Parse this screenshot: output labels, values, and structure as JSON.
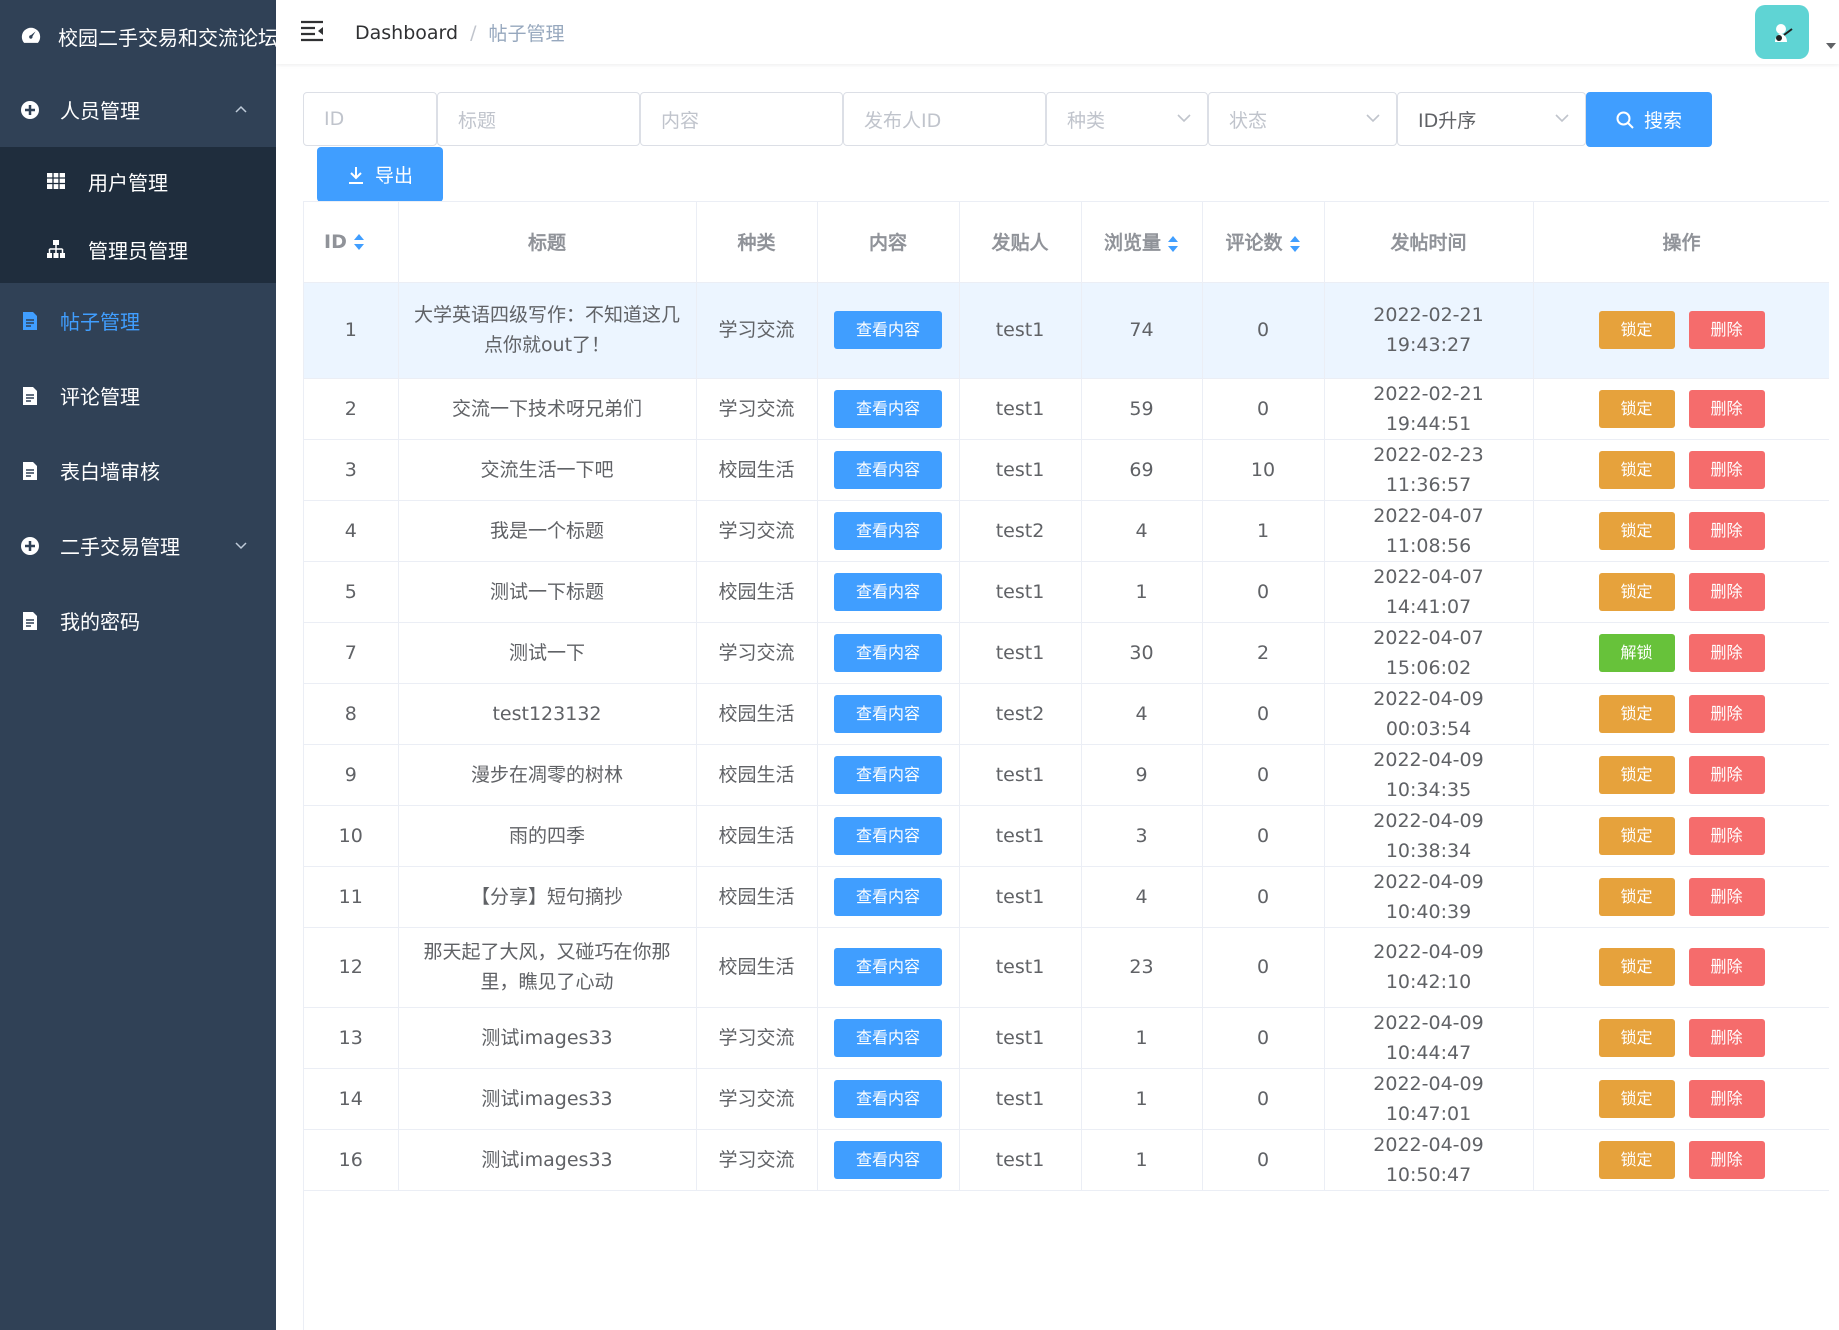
{
  "app_title": "校园二手交易和交流论坛管理系统",
  "sidebar": {
    "items": [
      {
        "label": "人员管理",
        "icon": "circle-plus-icon",
        "expanded": true,
        "children": [
          {
            "label": "用户管理",
            "icon": "table-grid-icon"
          },
          {
            "label": "管理员管理",
            "icon": "org-chart-icon"
          }
        ]
      },
      {
        "label": "帖子管理",
        "icon": "document-icon",
        "active": true
      },
      {
        "label": "评论管理",
        "icon": "document-icon"
      },
      {
        "label": "表白墙审核",
        "icon": "document-icon"
      },
      {
        "label": "二手交易管理",
        "icon": "circle-plus-icon",
        "expanded": false
      },
      {
        "label": "我的密码",
        "icon": "document-icon"
      }
    ]
  },
  "header": {
    "breadcrumb": [
      "Dashboard",
      "帖子管理"
    ],
    "avatar_icon": "user-avatar-icon"
  },
  "filters": {
    "id_placeholder": "ID",
    "title_placeholder": "标题",
    "content_placeholder": "内容",
    "poster_id_placeholder": "发布人ID",
    "category_placeholder": "种类",
    "status_placeholder": "状态",
    "sort_value": "ID升序",
    "search_label": "搜索",
    "export_label": "导出"
  },
  "table": {
    "headers": {
      "id": "ID",
      "title": "标题",
      "category": "种类",
      "content": "内容",
      "poster": "发贴人",
      "views": "浏览量",
      "comments": "评论数",
      "time": "发帖时间",
      "actions": "操作"
    },
    "view_label": "查看内容",
    "lock_label": "锁定",
    "unlock_label": "解锁",
    "delete_label": "删除",
    "rows": [
      {
        "id": "1",
        "title": "大学英语四级写作：不知道这几点你就out了！",
        "category": "学习交流",
        "poster": "test1",
        "views": "74",
        "comments": "0",
        "time": "2022-02-21 19:43:27",
        "locked": false
      },
      {
        "id": "2",
        "title": "交流一下技术呀兄弟们",
        "category": "学习交流",
        "poster": "test1",
        "views": "59",
        "comments": "0",
        "time": "2022-02-21 19:44:51",
        "locked": false
      },
      {
        "id": "3",
        "title": "交流生活一下吧",
        "category": "校园生活",
        "poster": "test1",
        "views": "69",
        "comments": "10",
        "time": "2022-02-23 11:36:57",
        "locked": false
      },
      {
        "id": "4",
        "title": "我是一个标题",
        "category": "学习交流",
        "poster": "test2",
        "views": "4",
        "comments": "1",
        "time": "2022-04-07 11:08:56",
        "locked": false
      },
      {
        "id": "5",
        "title": "测试一下标题",
        "category": "校园生活",
        "poster": "test1",
        "views": "1",
        "comments": "0",
        "time": "2022-04-07 14:41:07",
        "locked": false
      },
      {
        "id": "7",
        "title": "测试一下",
        "category": "学习交流",
        "poster": "test1",
        "views": "30",
        "comments": "2",
        "time": "2022-04-07 15:06:02",
        "locked": true
      },
      {
        "id": "8",
        "title": "test123132",
        "category": "校园生活",
        "poster": "test2",
        "views": "4",
        "comments": "0",
        "time": "2022-04-09 00:03:54",
        "locked": false
      },
      {
        "id": "9",
        "title": "漫步在凋零的树林",
        "category": "校园生活",
        "poster": "test1",
        "views": "9",
        "comments": "0",
        "time": "2022-04-09 10:34:35",
        "locked": false
      },
      {
        "id": "10",
        "title": "雨的四季",
        "category": "校园生活",
        "poster": "test1",
        "views": "3",
        "comments": "0",
        "time": "2022-04-09 10:38:34",
        "locked": false
      },
      {
        "id": "11",
        "title": "【分享】短句摘抄",
        "category": "校园生活",
        "poster": "test1",
        "views": "4",
        "comments": "0",
        "time": "2022-04-09 10:40:39",
        "locked": false
      },
      {
        "id": "12",
        "title": "那天起了大风，又碰巧在你那里，瞧见了心动",
        "category": "校园生活",
        "poster": "test1",
        "views": "23",
        "comments": "0",
        "time": "2022-04-09 10:42:10",
        "locked": false
      },
      {
        "id": "13",
        "title": "测试images33",
        "category": "学习交流",
        "poster": "test1",
        "views": "1",
        "comments": "0",
        "time": "2022-04-09 10:44:47",
        "locked": false
      },
      {
        "id": "14",
        "title": "测试images33",
        "category": "学习交流",
        "poster": "test1",
        "views": "1",
        "comments": "0",
        "time": "2022-04-09 10:47:01",
        "locked": false
      },
      {
        "id": "16",
        "title": "测试images33",
        "category": "学习交流",
        "poster": "test1",
        "views": "1",
        "comments": "0",
        "time": "2022-04-09 10:50:47",
        "locked": false
      }
    ]
  },
  "colors": {
    "sidebar_bg": "#304156",
    "submenu_bg": "#1f2d3d",
    "primary": "#409eff",
    "warning": "#e6a23c",
    "success": "#67c23a",
    "danger": "#f56c6c"
  }
}
